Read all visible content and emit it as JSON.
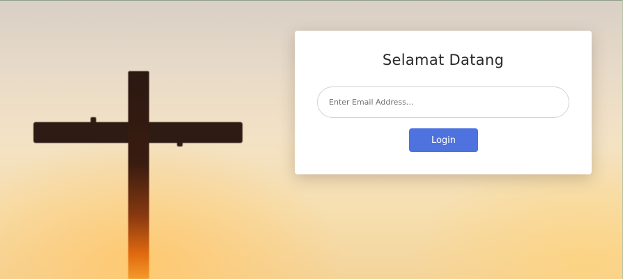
{
  "login_card": {
    "title": "Selamat Datang",
    "email_placeholder": "Enter Email Address...",
    "email_value": "",
    "login_label": "Login"
  },
  "colors": {
    "accent": "#4e73df",
    "card_background": "#ffffff",
    "title_text": "#2a2a2a"
  },
  "background": {
    "scene": "cross-at-sunset",
    "icon": "cross-icon"
  }
}
